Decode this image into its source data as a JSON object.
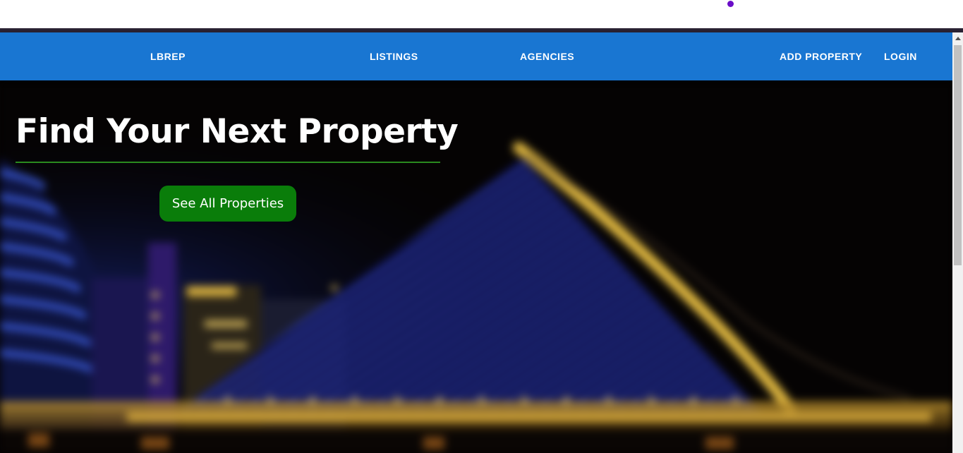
{
  "nav": {
    "brand": "LBREP",
    "listings": "LISTINGS",
    "agencies": "AGENCIES",
    "add_property": "ADD PROPERTY",
    "login": "LOGIN"
  },
  "hero": {
    "title": "Find Your Next Property",
    "cta_label": "See All Properties",
    "background_image": "night-city-harp-bridge"
  },
  "colors": {
    "navbar": "#1976d2",
    "cta": "#0a7d0a",
    "title_underline": "#2a8a1f",
    "loading_dot": "#6a0dc8"
  }
}
